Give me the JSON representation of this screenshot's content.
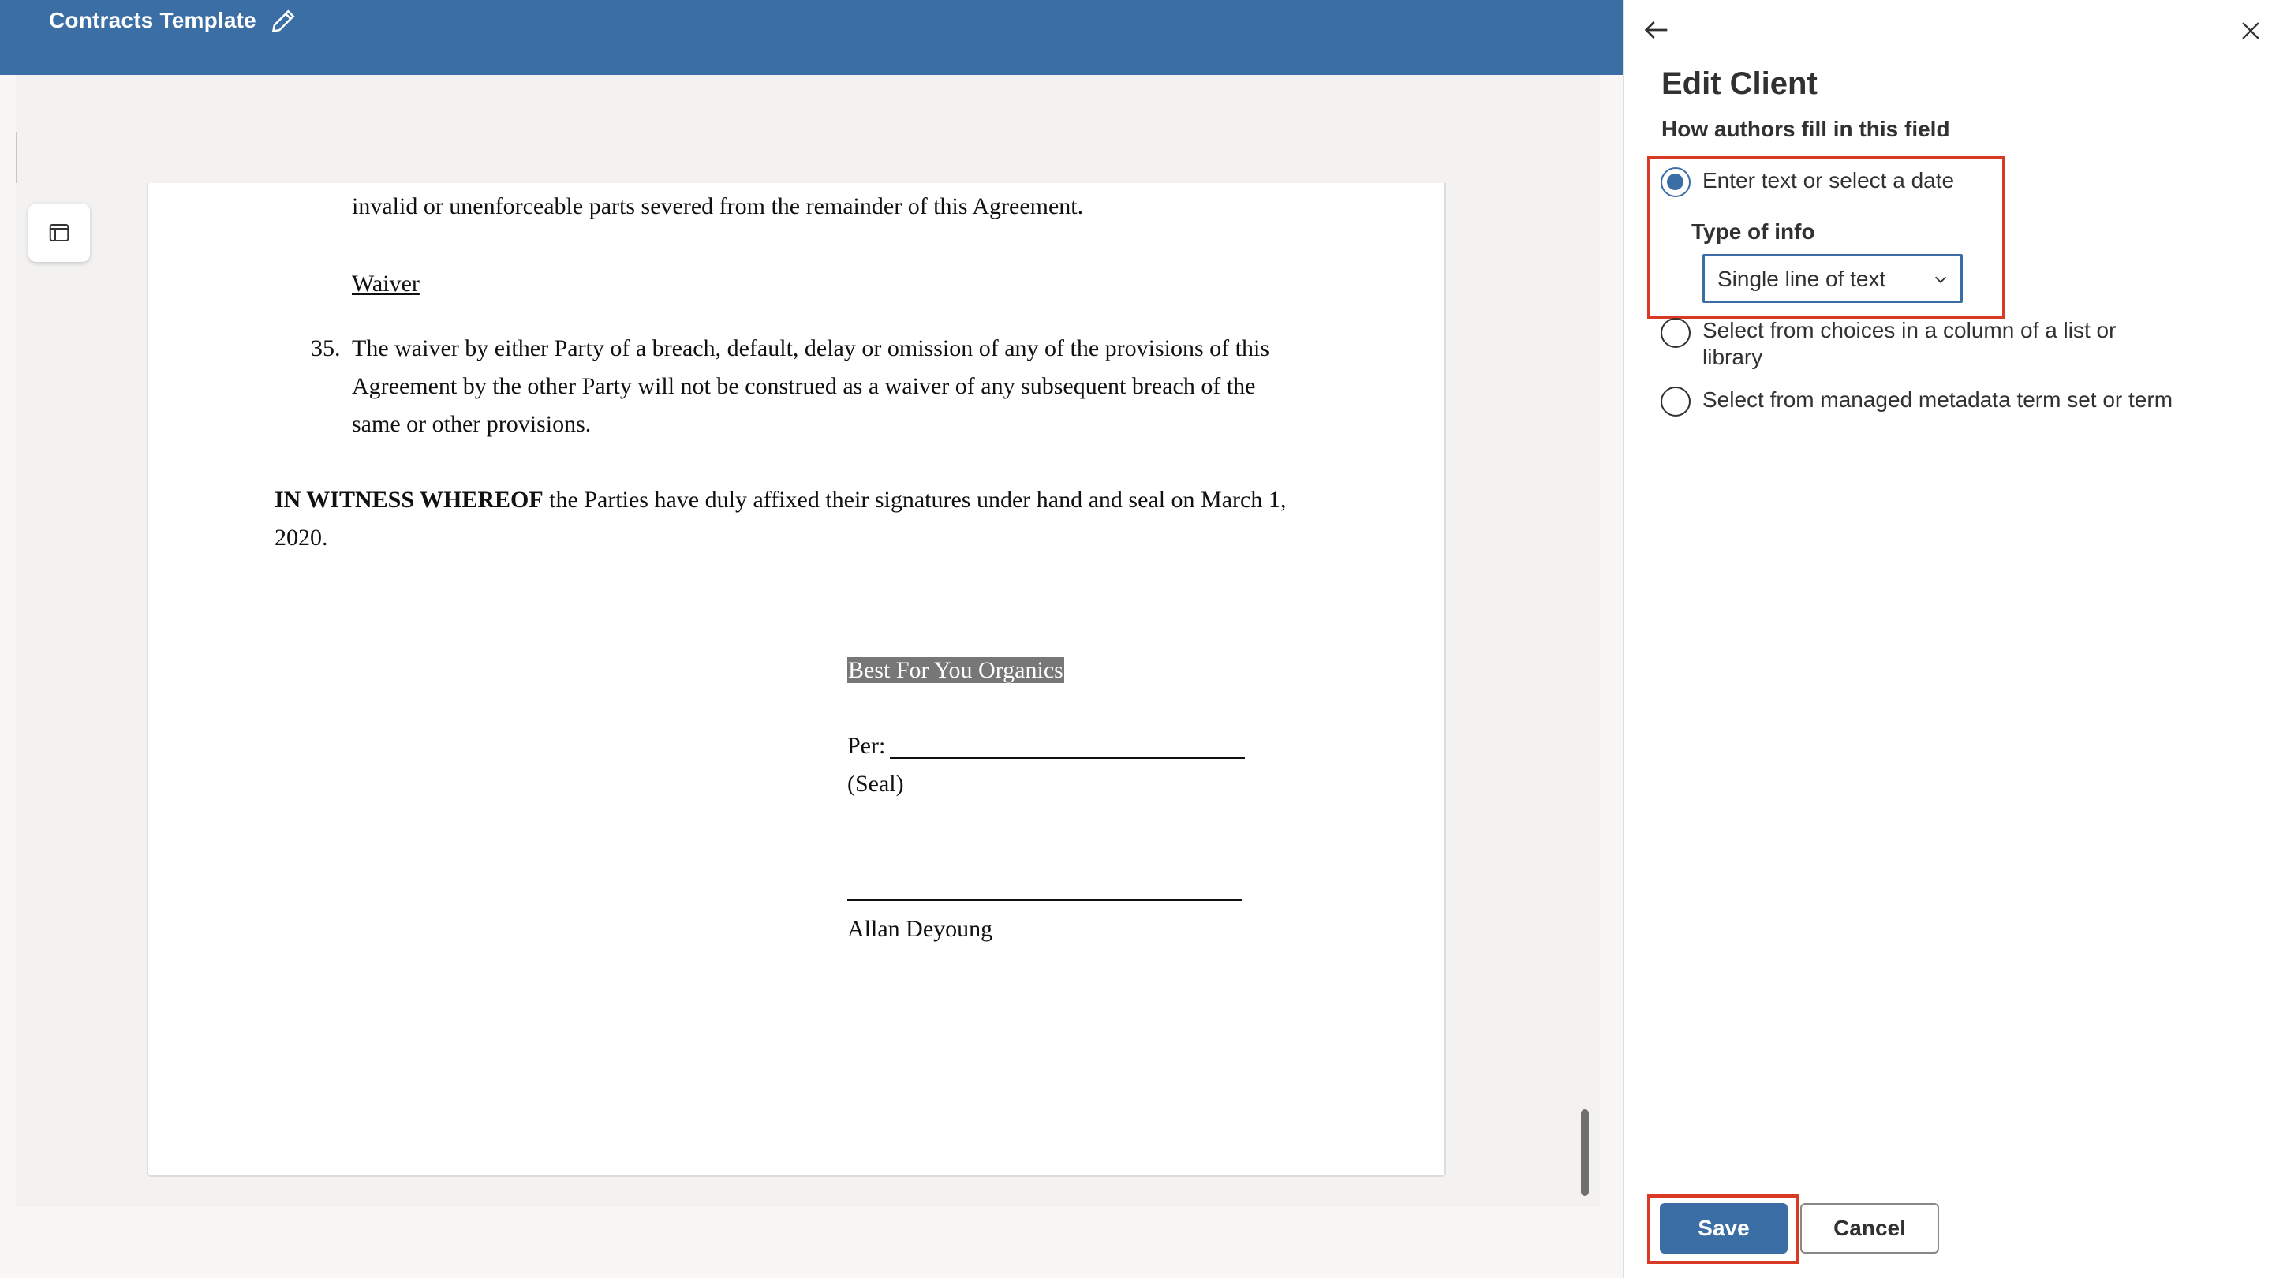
{
  "header": {
    "title": "Contracts Template",
    "edit_icon": "pencil-icon"
  },
  "document": {
    "line_partial": "invalid or unenforceable parts severed from the remainder of this Agreement.",
    "waiver_heading": "Waiver",
    "clause_number": "35.",
    "clause_lines": [
      "The waiver by either Party of a breach, default, delay or omission of any of the provisions of this",
      "Agreement by the other Party will not be construed as a waiver of any subsequent breach of the",
      "same or other provisions."
    ],
    "witness_bold": "IN WITNESS WHEREOF",
    "witness_rest": " the Parties have duly affixed their signatures under hand and seal on March 1,",
    "witness_line2": "2020.",
    "company": "Best For You Organics",
    "per_label": "Per:",
    "seal_label": "(Seal)",
    "signatory": "Allan Deyoung"
  },
  "panel": {
    "title": "Edit Client",
    "subtitle": "How authors fill in this field",
    "options": [
      {
        "label": "Enter text or select a date",
        "checked": true
      },
      {
        "label_line1": "Select from choices in a column of a list or",
        "label_line2": "library",
        "checked": false
      },
      {
        "label": "Select from managed metadata term set or term",
        "checked": false
      }
    ],
    "type_of_info_label": "Type of info",
    "type_of_info_value": "Single line of text",
    "save_label": "Save",
    "cancel_label": "Cancel"
  },
  "colors": {
    "brand": "#3a6ea5",
    "highlight_box": "#d93a26",
    "selection": "#777777"
  }
}
